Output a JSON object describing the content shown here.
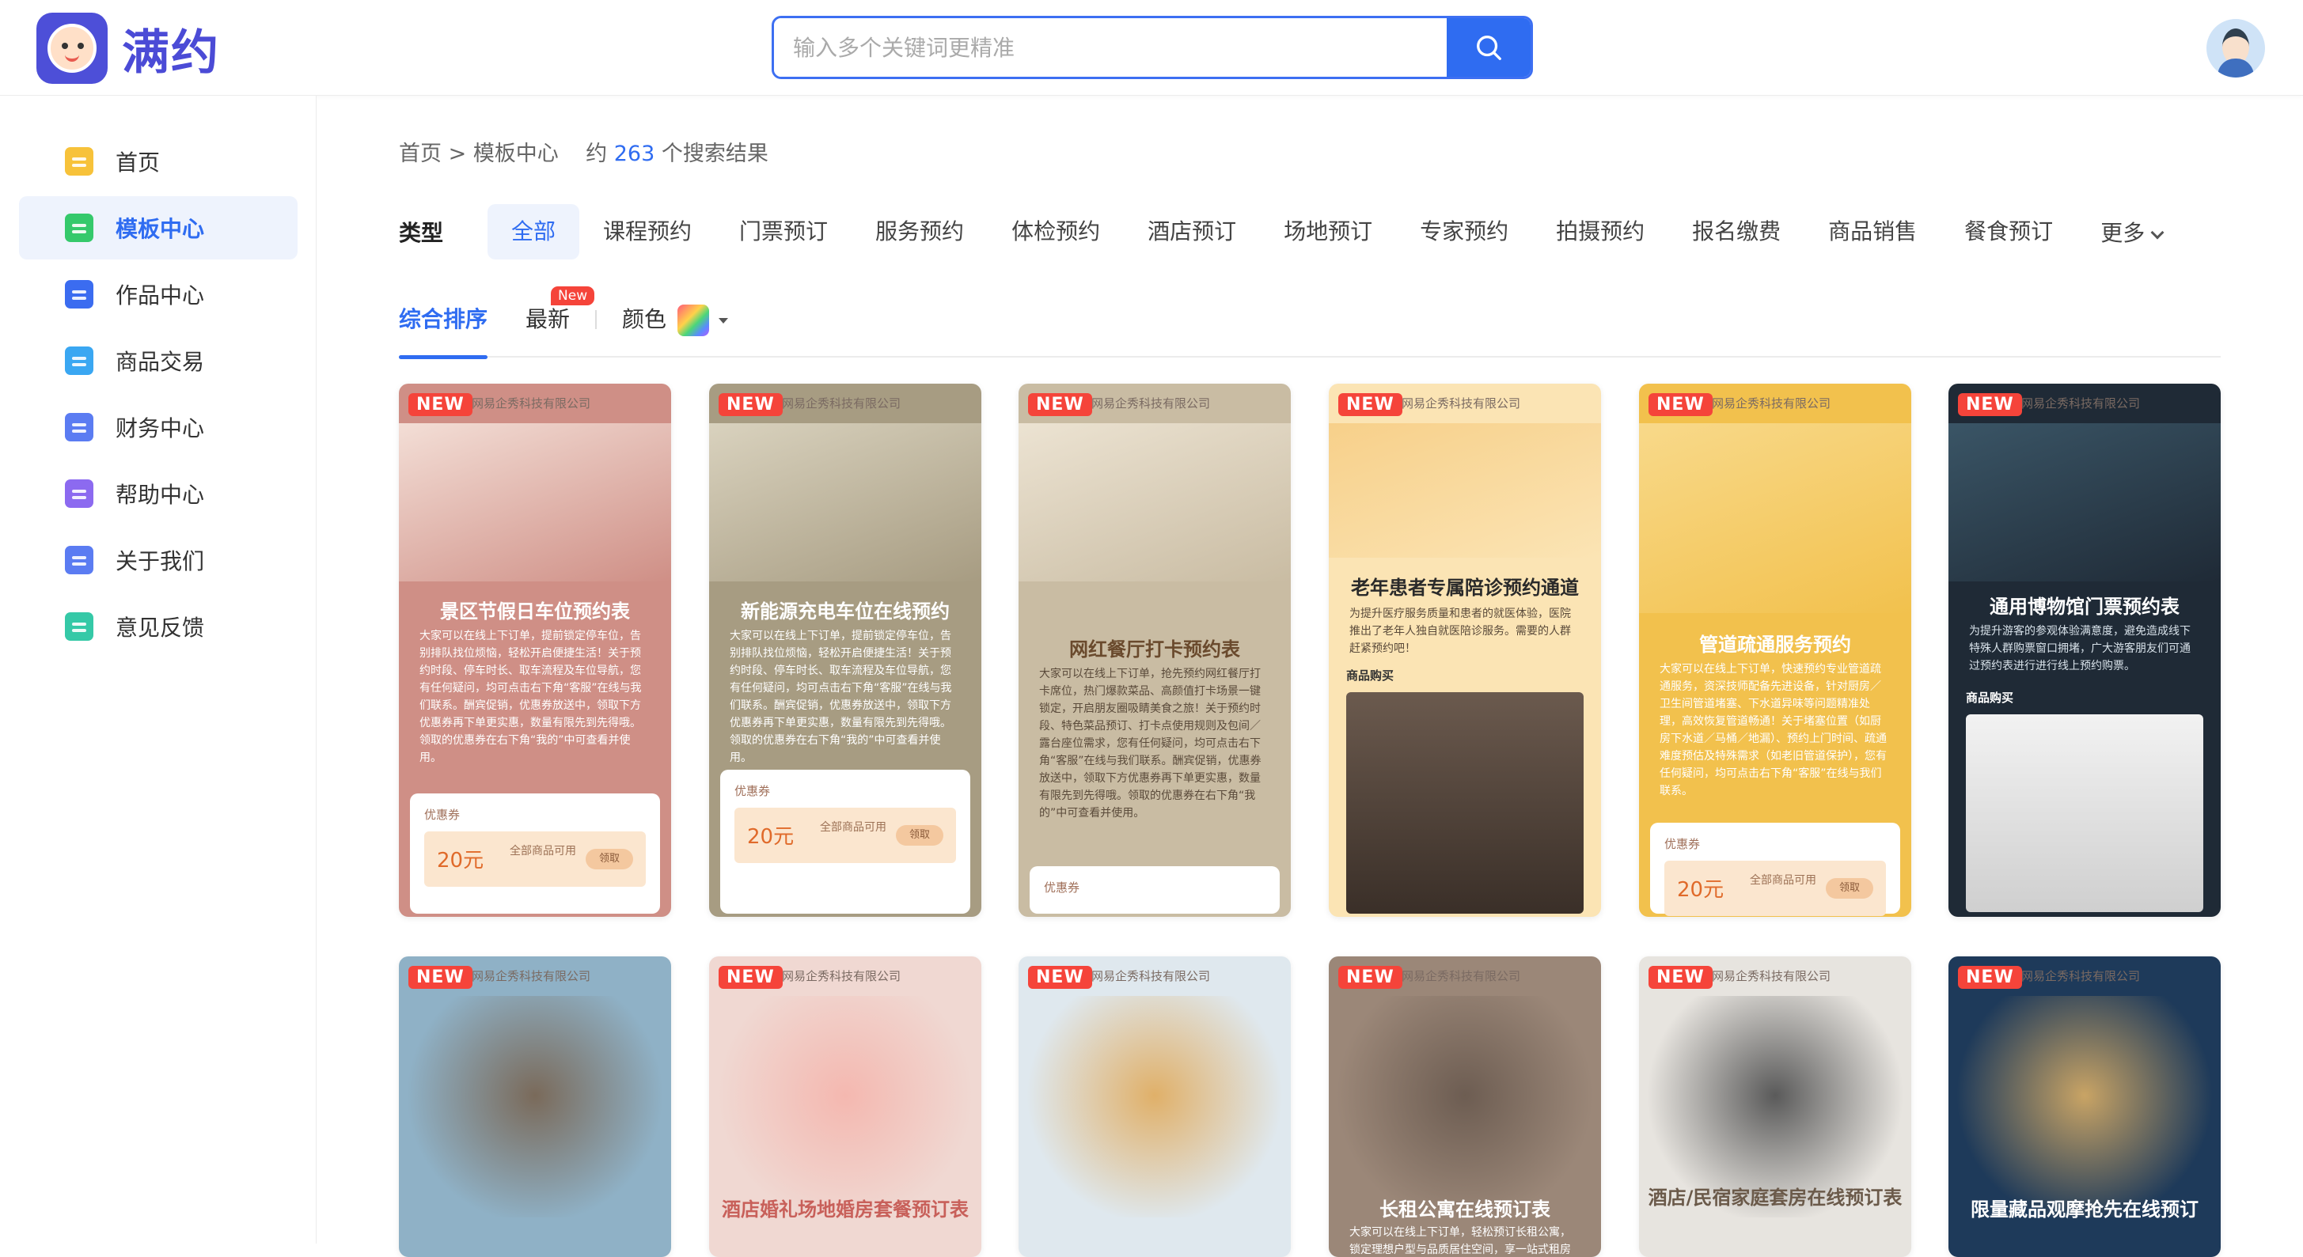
{
  "app": {
    "name": "满约"
  },
  "search": {
    "placeholder": "输入多个关键词更精准"
  },
  "sidebar": {
    "items": [
      {
        "label": "首页",
        "icon": "home-icon",
        "color": "#f7c23a"
      },
      {
        "label": "模板中心",
        "icon": "template-icon",
        "color": "#35c96b"
      },
      {
        "label": "作品中心",
        "icon": "works-icon",
        "color": "#3b6cf0"
      },
      {
        "label": "商品交易",
        "icon": "shopping-bag-icon",
        "color": "#3aa7f2"
      },
      {
        "label": "财务中心",
        "icon": "calculator-icon",
        "color": "#5b7cf2"
      },
      {
        "label": "帮助中心",
        "icon": "book-icon",
        "color": "#8c6af0"
      },
      {
        "label": "关于我们",
        "icon": "user-icon",
        "color": "#5b7cf2"
      },
      {
        "label": "意见反馈",
        "icon": "feedback-icon",
        "color": "#35c9a7"
      }
    ],
    "active_index": 1
  },
  "breadcrumb": {
    "home": "首页",
    "sep": ">",
    "current": "模板中心",
    "prefix": "约",
    "count": "263",
    "suffix": "个搜索结果"
  },
  "filters": {
    "type_label": "类型",
    "types": [
      "全部",
      "课程预约",
      "门票预订",
      "服务预约",
      "体检预约",
      "酒店预订",
      "场地预订",
      "专家预约",
      "拍摄预约",
      "报名缴费",
      "商品销售",
      "餐食预订"
    ],
    "more": "更多"
  },
  "sort": {
    "comprehensive": "综合排序",
    "latest": "最新",
    "new_badge": "New",
    "color": "颜色"
  },
  "card_common": {
    "new_label": "NEW",
    "company": "网易企秀科技有限公司",
    "coupon_label": "优惠券",
    "coupon_value": "20元",
    "coupon_text": "全部商品可用",
    "coupon_btn": "领取",
    "goods_label": "商品购买"
  },
  "cards": [
    {
      "title": "景区节假日车位预约表",
      "body": "大家可以在线上下订单，提前锁定停车位，告别排队找位烦恼，轻松开启便捷生活！关于预约时段、停车时长、取车流程及车位导航，您有任何疑问，均可点击右下角“客服”在线与我们联系。酬宾促销，优惠券放送中，领取下方优惠券再下单更实惠，数量有限先到先得哦。领取的优惠券在右下角“我的”中可查看并使用。",
      "bg": "#cf8f86",
      "accent": "#f3ded6",
      "title_color": "#fff"
    },
    {
      "title": "新能源充电车位在线预约",
      "body": "大家可以在线上下订单，提前锁定停车位，告别排队找位烦恼，轻松开启便捷生活！关于预约时段、停车时长、取车流程及车位导航，您有任何疑问，均可点击右下角“客服”在线与我们联系。酬宾促销，优惠券放送中，领取下方优惠券再下单更实惠，数量有限先到先得哦。领取的优惠券在右下角“我的”中可查看并使用。",
      "bg": "#a79c82",
      "accent": "#d9d2be",
      "title_color": "#fff"
    },
    {
      "title": "网红餐厅打卡预约表",
      "body": "大家可以在线上下订单，抢先预约网红餐厅打卡席位，热门爆款菜品、高颜值打卡场景一键锁定，开启朋友圈吸睛美食之旅！关于预约时段、特色菜品预订、打卡点使用规则及包间／露台座位需求，您有任何疑问，均可点击右下角“客服”在线与我们联系。酬宾促销，优惠券放送中，领取下方优惠券再下单更实惠，数量有限先到先得哦。领取的优惠券在右下角“我的”中可查看并使用。",
      "bg": "#c9bca3",
      "accent": "#ece3d2",
      "title_color": "#6a4a2d"
    },
    {
      "title": "老年患者专属陪诊预约通道",
      "body": "为提升医疗服务质量和患者的就医体验，医院推出了老年人独自就医陪诊服务。需要的人群赶紧预约吧！",
      "bg": "#fbe4b4",
      "accent": "#f7d08a",
      "title_color": "#2a2a2a"
    },
    {
      "title": "管道疏通服务预约",
      "body": "大家可以在线上下订单，快速预约专业管道疏通服务，资深技师配备先进设备，针对厨房／卫生间管道堵塞、下水道异味等问题精准处理，高效恢复管道畅通！关于堵塞位置（如厨房下水道／马桶／地漏）、预约上门时间、疏通难度预估及特殊需求（如老旧管道保护），您有任何疑问，均可点击右下角“客服”在线与我们联系。",
      "bg": "#f2c14d",
      "accent": "#f8d98a",
      "title_color": "#fff"
    },
    {
      "title": "通用博物馆门票预约表",
      "body": "为提升游客的参观体验满意度，避免造成线下特殊人群购票窗口拥堵，广大游客朋友们可通过预约表进行进行线上预约购票。",
      "bg": "#1f2a36",
      "accent": "#3a5566",
      "title_color": "#fff"
    },
    {
      "title": "",
      "body": "",
      "bg": "#8fb1c6",
      "accent": "#7a6a5a",
      "title_color": "#fff"
    },
    {
      "title": "酒店婚礼场地婚房套餐预订表",
      "body": "",
      "bg": "#f0d8d2",
      "accent": "#f4b8b0",
      "title_color": "#c8605a"
    },
    {
      "title": "",
      "body": "",
      "bg": "#dfe8ee",
      "accent": "#e0b069",
      "title_color": "#fff"
    },
    {
      "title": "长租公寓在线预订表",
      "body": "大家可以在线上下订单，轻松预订长租公寓，锁定理想户型与品质居住空间，享一站式租房服务。",
      "bg": "#9b8778",
      "accent": "#6d5d52",
      "title_color": "#fff"
    },
    {
      "title": "酒店/民宿家庭套房在线预订表",
      "body": "",
      "bg": "#e7e4df",
      "accent": "#5a5a5a",
      "title_color": "#6b5a4a"
    },
    {
      "title": "限量藏品观摩抢先在线预订",
      "body": "",
      "bg": "#1e3a5a",
      "accent": "#c9a465",
      "title_color": "#fff"
    }
  ]
}
